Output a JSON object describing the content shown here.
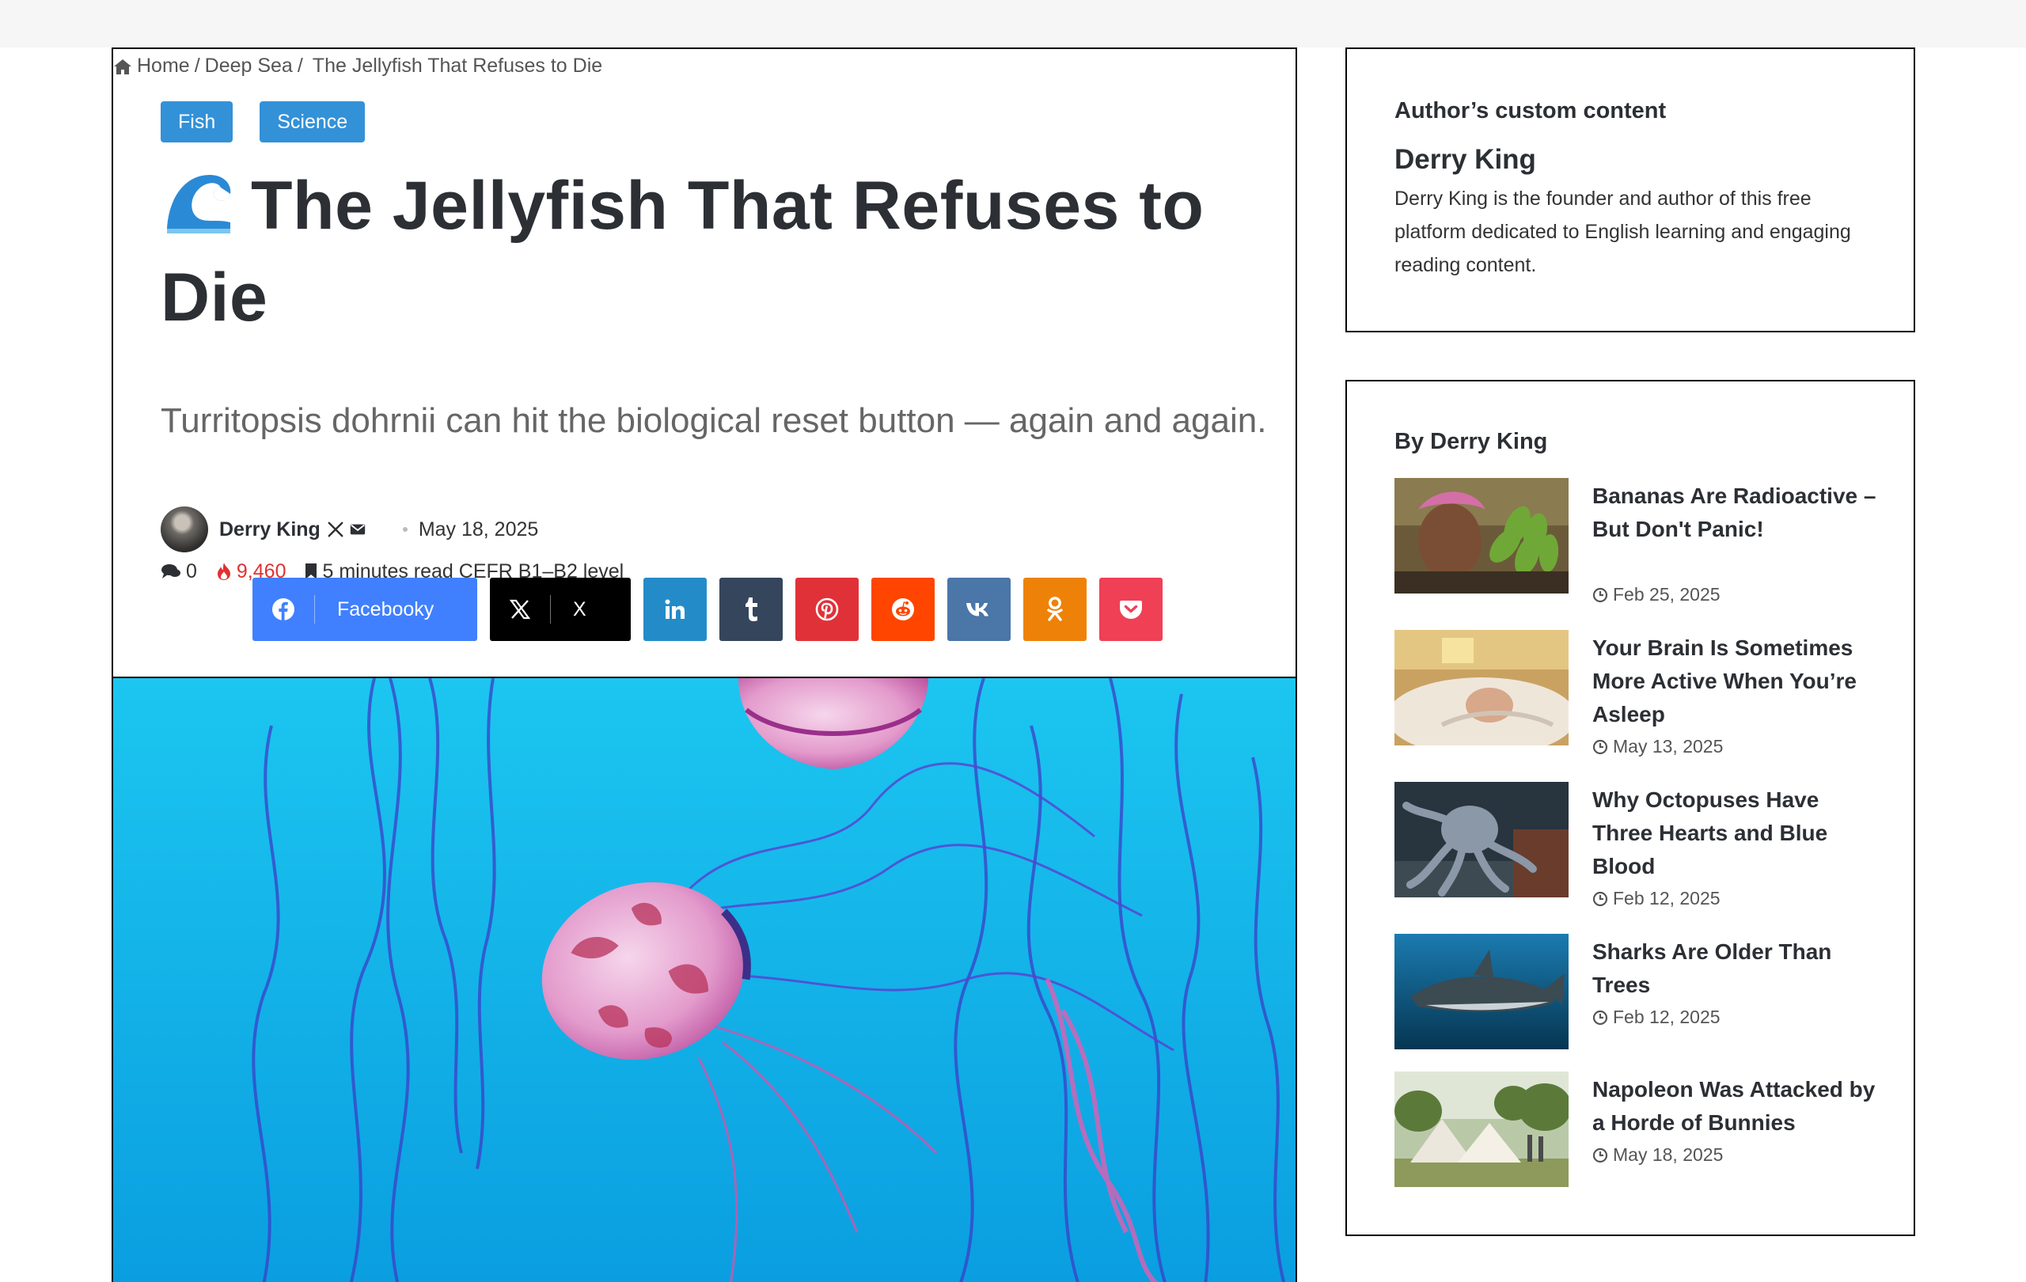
{
  "breadcrumb": {
    "home": "Home",
    "section": "Deep Sea",
    "current": "The Jellyfish That Refuses to Die",
    "sep": "/"
  },
  "categories": [
    "Fish",
    "Science"
  ],
  "article": {
    "title": "The Jellyfish That Refuses to Die",
    "subtitle": "Turritopsis dohrnii can hit the biological reset button — again and again.",
    "author": "Derry King",
    "date": "May 18, 2025",
    "comments": "0",
    "views": "9,460",
    "read_time": "5 minutes read CEFR B1–B2 level"
  },
  "share": {
    "facebook": "Facebooky",
    "x": "X"
  },
  "sidebar": {
    "author_widget": {
      "title": "Author’s custom content",
      "heading": "Derry King",
      "text": "Derry King is the founder and author of this free platform dedicated to English learning and engaging reading content."
    },
    "posts_widget": {
      "title": "By Derry King",
      "posts": [
        {
          "title": "Bananas Are Radioactive – But Don't Panic!",
          "date": "Feb 25, 2025"
        },
        {
          "title": "Your Brain Is Sometimes More Active When You’re Asleep",
          "date": "May 13, 2025"
        },
        {
          "title": "Why Octopuses Have Three Hearts and Blue Blood",
          "date": "Feb 12, 2025"
        },
        {
          "title": "Sharks Are Older Than Trees",
          "date": "Feb 12, 2025"
        },
        {
          "title": "Napoleon Was Attacked by a Horde of Bunnies",
          "date": "May 18, 2025"
        }
      ]
    }
  },
  "colors": {
    "category_bg": "#3391d8",
    "views": "#e03131",
    "facebook": "#4080ff",
    "hero_water": "#12b4e8"
  }
}
